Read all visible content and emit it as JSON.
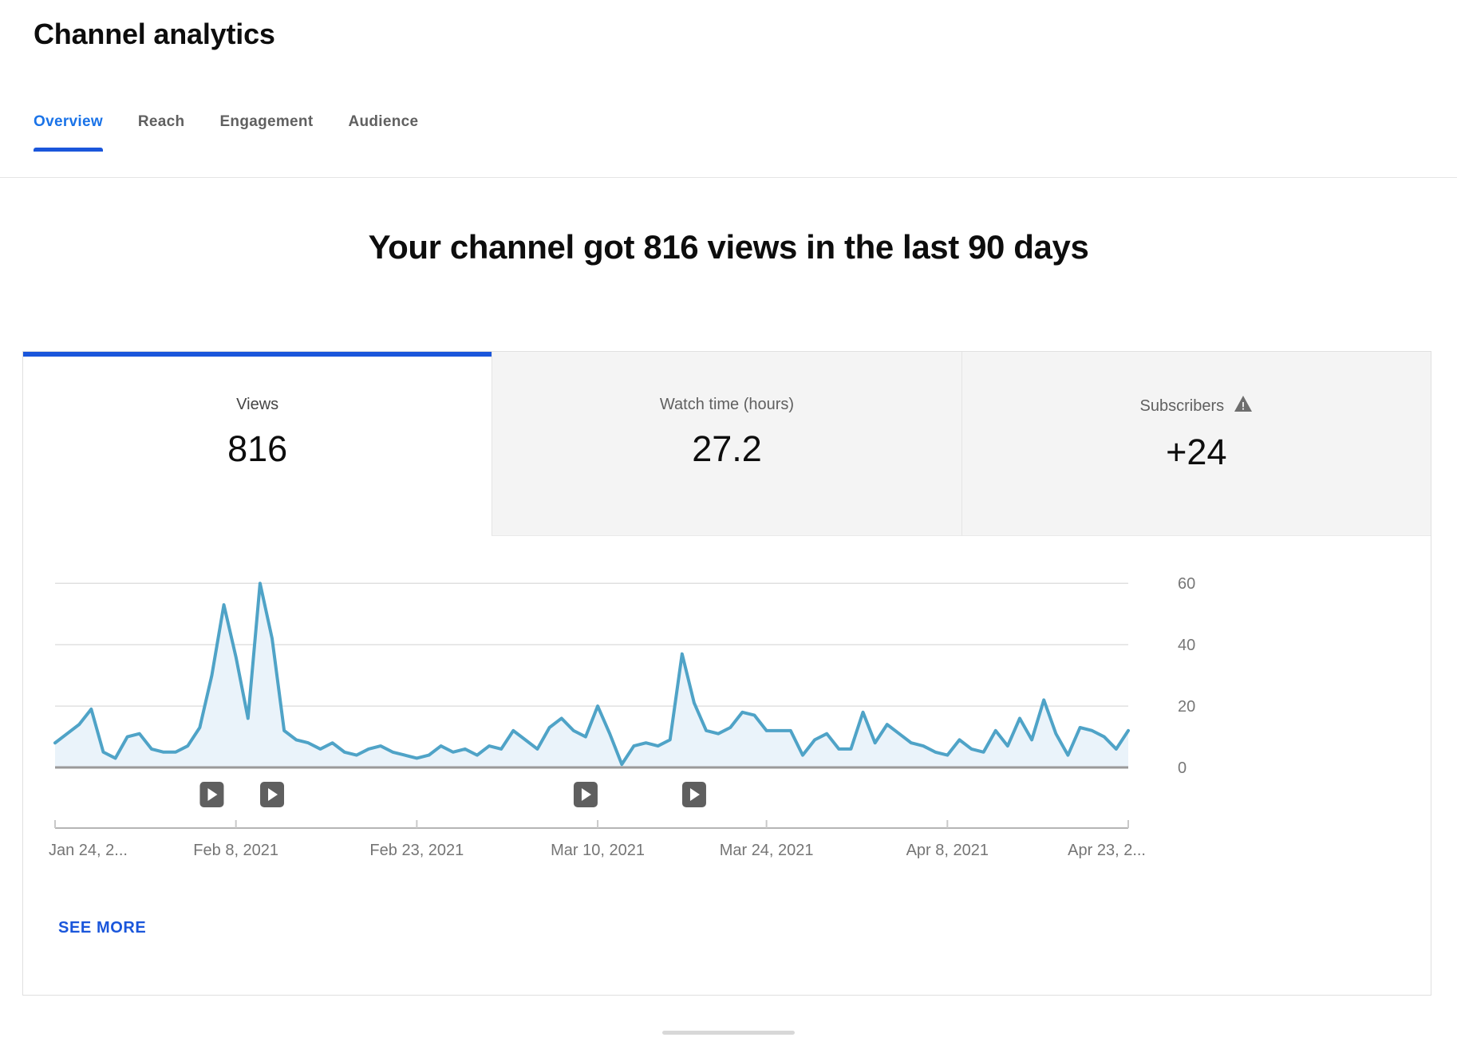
{
  "header": {
    "title": "Channel analytics"
  },
  "tabs": [
    {
      "label": "Overview",
      "active": true
    },
    {
      "label": "Reach",
      "active": false
    },
    {
      "label": "Engagement",
      "active": false
    },
    {
      "label": "Audience",
      "active": false
    }
  ],
  "headline": "Your channel got 816 views in the last 90 days",
  "metrics": [
    {
      "label": "Views",
      "value": "816",
      "active": true,
      "warning": false
    },
    {
      "label": "Watch time (hours)",
      "value": "27.2",
      "active": false,
      "warning": false
    },
    {
      "label": "Subscribers",
      "value": "+24",
      "active": false,
      "warning": true
    }
  ],
  "see_more_label": "SEE MORE",
  "colors": {
    "accent": "#1a56db",
    "link": "#1a56db",
    "line": "#4fa3c7",
    "area": "#eaf3fa",
    "grid": "#e0e0e0",
    "axis": "#8d8d8d",
    "marker": "#5f5f5f"
  },
  "chart_data": {
    "type": "area",
    "title": "",
    "xlabel": "",
    "ylabel": "",
    "ylim": [
      0,
      65
    ],
    "yticks": [
      0,
      20,
      40,
      60
    ],
    "ytick_labels": [
      "0",
      "20",
      "40",
      "60"
    ],
    "grid": true,
    "legend": "none",
    "xtick_labels": [
      "Jan 24, 2...",
      "Feb 8, 2021",
      "Feb 23, 2021",
      "Mar 10, 2021",
      "Mar 24, 2021",
      "Apr 8, 2021",
      "Apr 23, 2..."
    ],
    "xtick_indices": [
      0,
      15,
      30,
      45,
      59,
      74,
      89
    ],
    "series_name": "Views",
    "values": [
      8,
      11,
      14,
      19,
      5,
      3,
      10,
      11,
      6,
      5,
      5,
      7,
      13,
      30,
      53,
      36,
      16,
      60,
      42,
      12,
      9,
      8,
      6,
      8,
      5,
      4,
      6,
      7,
      5,
      4,
      3,
      4,
      7,
      5,
      6,
      4,
      7,
      6,
      12,
      9,
      6,
      13,
      16,
      12,
      10,
      20,
      11,
      1,
      7,
      8,
      7,
      9,
      37,
      21,
      12,
      11,
      13,
      18,
      17,
      12,
      12,
      12,
      4,
      9,
      11,
      6,
      6,
      18,
      8,
      14,
      11,
      8,
      7,
      5,
      4,
      9,
      6,
      5,
      12,
      7,
      16,
      9,
      22,
      11,
      4,
      13,
      12,
      10,
      6,
      12
    ],
    "video_markers": [
      {
        "label": "video-marker",
        "index": 13
      },
      {
        "label": "video-marker",
        "index": 18
      },
      {
        "label": "video-marker",
        "index": 44
      },
      {
        "label": "video-marker",
        "index": 53
      }
    ]
  }
}
